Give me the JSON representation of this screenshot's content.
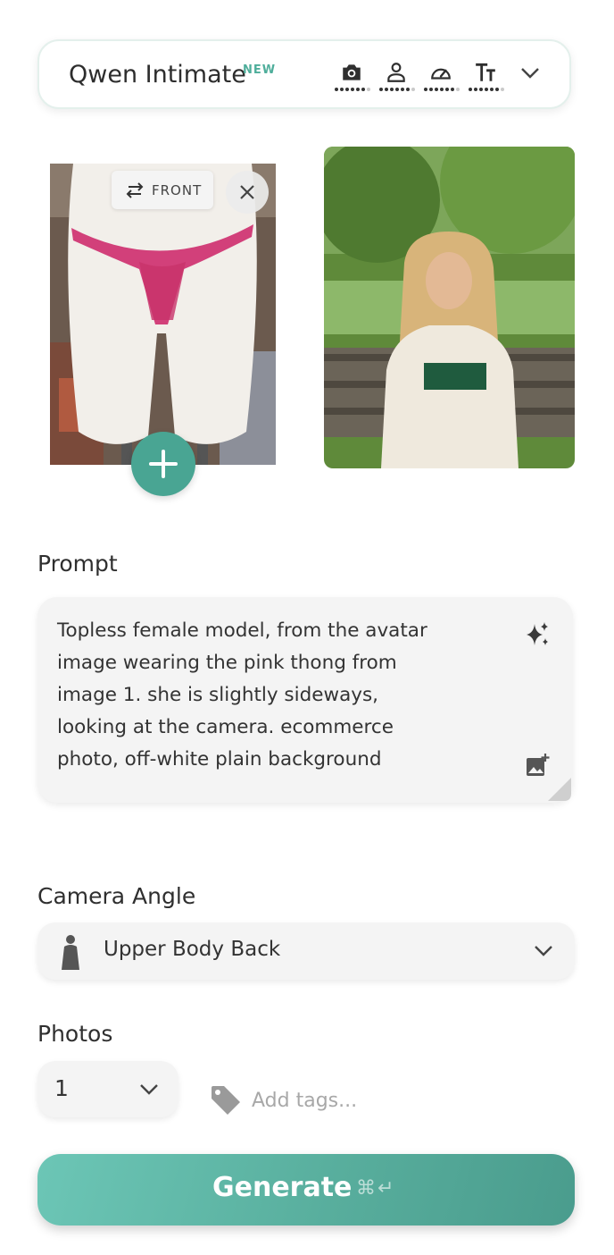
{
  "model_selector": {
    "name": "Qwen Intimate",
    "badge": "NEW",
    "icons": [
      "camera-icon",
      "person-icon",
      "speed-icon",
      "text-size-icon",
      "chevron-down-icon"
    ]
  },
  "garment": {
    "view_label": "FRONT"
  },
  "prompt": {
    "label": "Prompt",
    "text": "Topless female model, from the avatar image wearing the pink thong from image 1. she is slightly sideways, looking at the camera. ecommerce photo, off-white plain background"
  },
  "camera_angle": {
    "label": "Camera Angle",
    "value": "Upper Body Back"
  },
  "photos": {
    "label": "Photos",
    "count": "1",
    "tags_placeholder": "Add tags..."
  },
  "generate": {
    "label": "Generate",
    "shortcut": "⌘↵"
  },
  "colors": {
    "accent": "#49a593",
    "button_start": "#6cc6b6",
    "button_end": "#4a9c8d",
    "box_bg": "#f4f4f4"
  }
}
